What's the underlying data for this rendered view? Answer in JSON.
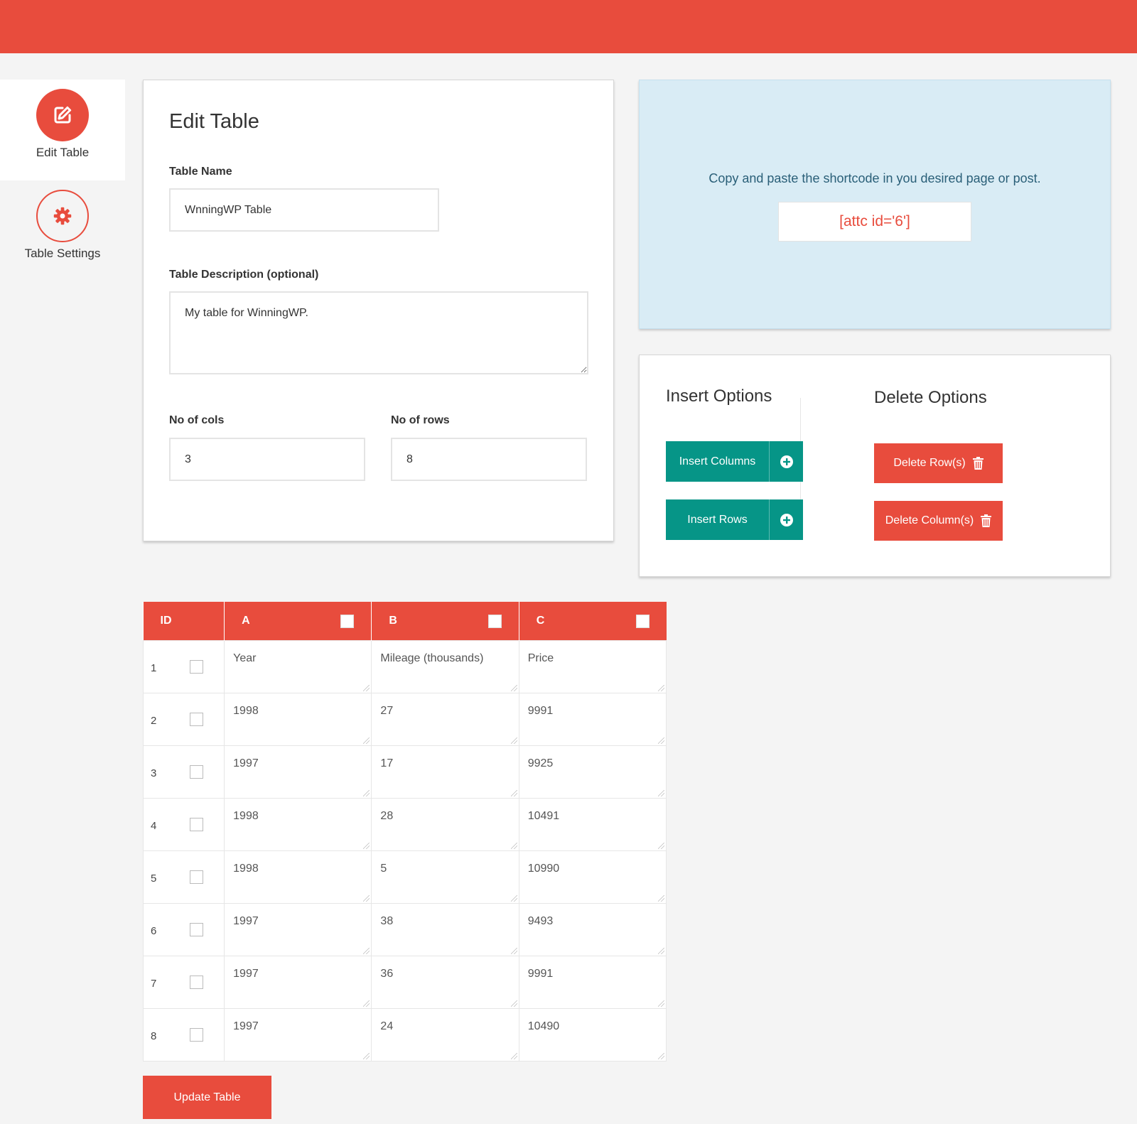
{
  "sidebar": {
    "items": [
      {
        "label": "Edit Table",
        "icon": "edit-icon"
      },
      {
        "label": "Table Settings",
        "icon": "gear-icon"
      }
    ]
  },
  "edit": {
    "title": "Edit Table",
    "name_label": "Table Name",
    "name_value": "WnningWP Table",
    "desc_label": "Table Description (optional)",
    "desc_value": "My table for WinningWP.",
    "cols_label": "No of cols",
    "cols_value": "3",
    "rows_label": "No of rows",
    "rows_value": "8"
  },
  "shortcode": {
    "message": "Copy and paste the shortcode in you desired page or post.",
    "code": "[attc id='6']"
  },
  "options": {
    "insert_title": "Insert Options",
    "delete_title": "Delete Options",
    "insert_columns": "Insert Columns",
    "insert_rows": "Insert Rows",
    "delete_rows": "Delete Row(s)",
    "delete_columns": "Delete Column(s)"
  },
  "table": {
    "headers": [
      "ID",
      "A",
      "B",
      "C"
    ],
    "rows": [
      {
        "id": "1",
        "cells": [
          "Year",
          "Mileage (thousands)",
          "Price"
        ]
      },
      {
        "id": "2",
        "cells": [
          "1998",
          "27",
          "9991"
        ]
      },
      {
        "id": "3",
        "cells": [
          "1997",
          "17",
          "9925"
        ]
      },
      {
        "id": "4",
        "cells": [
          "1998",
          "28",
          "10491"
        ]
      },
      {
        "id": "5",
        "cells": [
          "1998",
          "5",
          "10990"
        ]
      },
      {
        "id": "6",
        "cells": [
          "1997",
          "38",
          "9493"
        ]
      },
      {
        "id": "7",
        "cells": [
          "1997",
          "36",
          "9991"
        ]
      },
      {
        "id": "8",
        "cells": [
          "1997",
          "24",
          "10490"
        ]
      }
    ]
  },
  "update_label": "Update Table",
  "colors": {
    "brand_red": "#e84c3d",
    "teal": "#069587",
    "info_bg": "#d9ecf5"
  }
}
